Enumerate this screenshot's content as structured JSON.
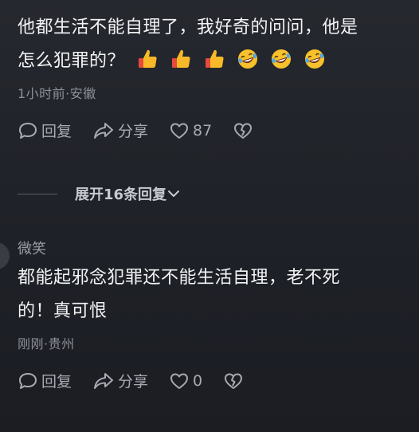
{
  "comment1": {
    "text_line1": "他都生活不能自理了，我好奇的问问，他是",
    "text_line2": "怎么犯罪的？",
    "emojis": [
      "thumbs-up-icon",
      "thumbs-up-icon",
      "thumbs-up-icon",
      "laughing-face-icon",
      "laughing-face-icon",
      "laughing-face-icon"
    ],
    "meta": "1小时前·安徽",
    "reply_label": "回复",
    "share_label": "分享",
    "like_count": "87"
  },
  "expand": {
    "label": "展开16条回复"
  },
  "comment2": {
    "username": "微笑",
    "text_line1": "都能起邪念犯罪还不能生活自理，老不死",
    "text_line2": "的！真可恨",
    "meta": "刚刚·贵州",
    "reply_label": "回复",
    "share_label": "分享",
    "like_count": "0"
  },
  "colors": {
    "background": "#23252c",
    "text": "#f3f3f5",
    "meta": "#8e9099",
    "thumb": "#f7b928",
    "thumb_cuff": "#e64a3c"
  }
}
